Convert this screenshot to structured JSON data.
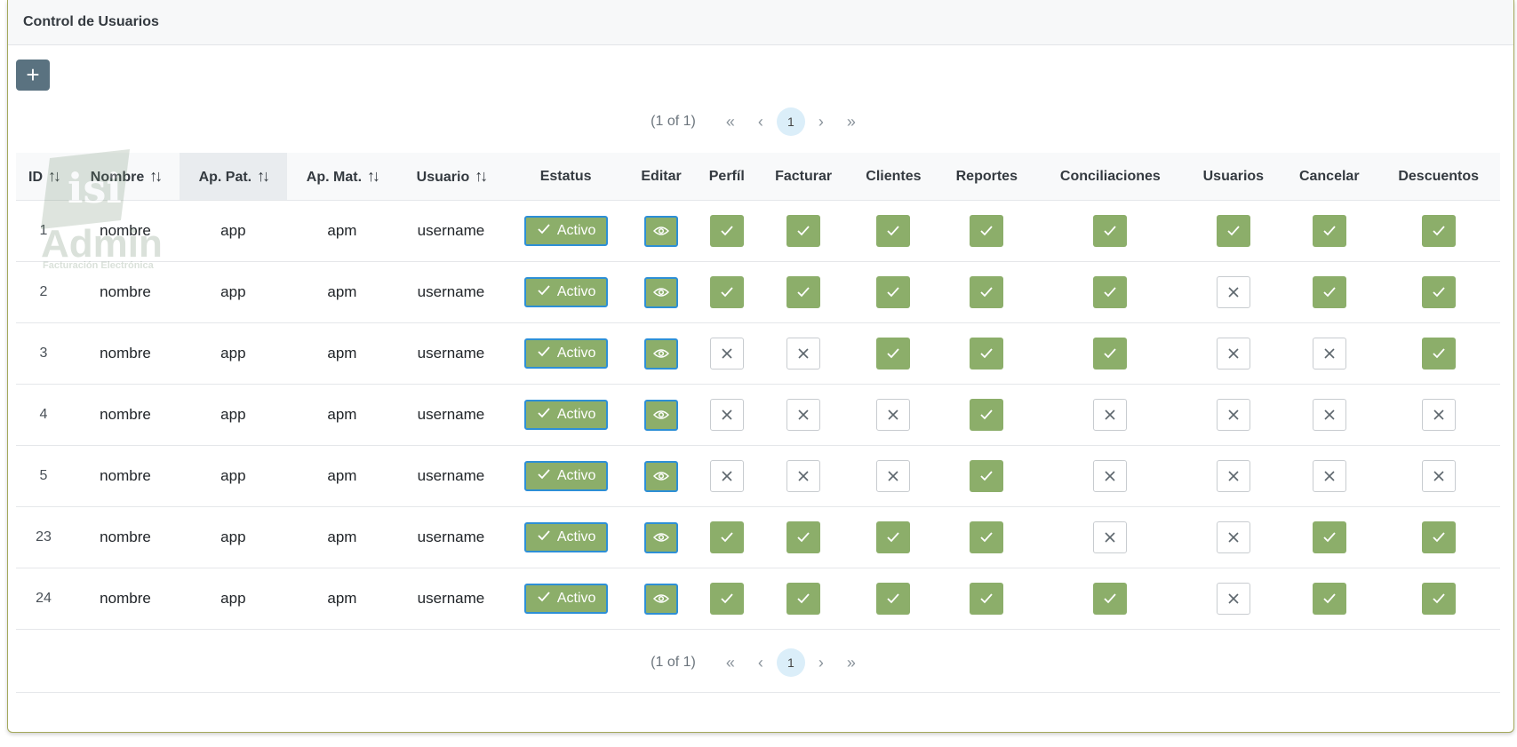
{
  "header": {
    "title": "Control de Usuarios"
  },
  "toolbar": {
    "add_label": "+"
  },
  "watermark": {
    "text": "Admin",
    "subtitle": "Facturación Electrónica"
  },
  "paginator": {
    "report": "(1 of 1)",
    "first": "«",
    "prev": "‹",
    "page": "1",
    "next": "›",
    "last": "»"
  },
  "columns": [
    {
      "label": "ID",
      "sortable": true
    },
    {
      "label": "Nombre",
      "sortable": true
    },
    {
      "label": "Ap. Pat.",
      "sortable": true,
      "sorted": true
    },
    {
      "label": "Ap. Mat.",
      "sortable": true
    },
    {
      "label": "Usuario",
      "sortable": true
    },
    {
      "label": "Estatus",
      "sortable": false
    },
    {
      "label": "Editar",
      "sortable": false
    },
    {
      "label": "Perfíl",
      "sortable": false
    },
    {
      "label": "Facturar",
      "sortable": false
    },
    {
      "label": "Clientes",
      "sortable": false
    },
    {
      "label": "Reportes",
      "sortable": false
    },
    {
      "label": "Conciliaciones",
      "sortable": false
    },
    {
      "label": "Usuarios",
      "sortable": false
    },
    {
      "label": "Cancelar",
      "sortable": false
    },
    {
      "label": "Descuentos",
      "sortable": false
    }
  ],
  "sort_glyph": "↑↓",
  "status_label": "Activo",
  "colors": {
    "accent_green": "#8cae6a",
    "focus_blue": "#2d8fd6",
    "add_button": "#5a7280"
  },
  "rows": [
    {
      "id": "1",
      "nombre": "nombre",
      "app": "app",
      "apm": "apm",
      "usuario": "username",
      "perms": [
        1,
        1,
        1,
        1,
        1,
        1,
        1,
        1
      ]
    },
    {
      "id": "2",
      "nombre": "nombre",
      "app": "app",
      "apm": "apm",
      "usuario": "username",
      "perms": [
        1,
        1,
        1,
        1,
        1,
        0,
        1,
        1
      ]
    },
    {
      "id": "3",
      "nombre": "nombre",
      "app": "app",
      "apm": "apm",
      "usuario": "username",
      "perms": [
        0,
        0,
        1,
        1,
        1,
        0,
        0,
        1
      ]
    },
    {
      "id": "4",
      "nombre": "nombre",
      "app": "app",
      "apm": "apm",
      "usuario": "username",
      "perms": [
        0,
        0,
        0,
        1,
        0,
        0,
        0,
        0
      ]
    },
    {
      "id": "5",
      "nombre": "nombre",
      "app": "app",
      "apm": "apm",
      "usuario": "username",
      "perms": [
        0,
        0,
        0,
        1,
        0,
        0,
        0,
        0
      ]
    },
    {
      "id": "23",
      "nombre": "nombre",
      "app": "app",
      "apm": "apm",
      "usuario": "username",
      "perms": [
        1,
        1,
        1,
        1,
        0,
        0,
        1,
        1
      ]
    },
    {
      "id": "24",
      "nombre": "nombre",
      "app": "app",
      "apm": "apm",
      "usuario": "username",
      "perms": [
        1,
        1,
        1,
        1,
        1,
        0,
        1,
        1
      ]
    }
  ]
}
